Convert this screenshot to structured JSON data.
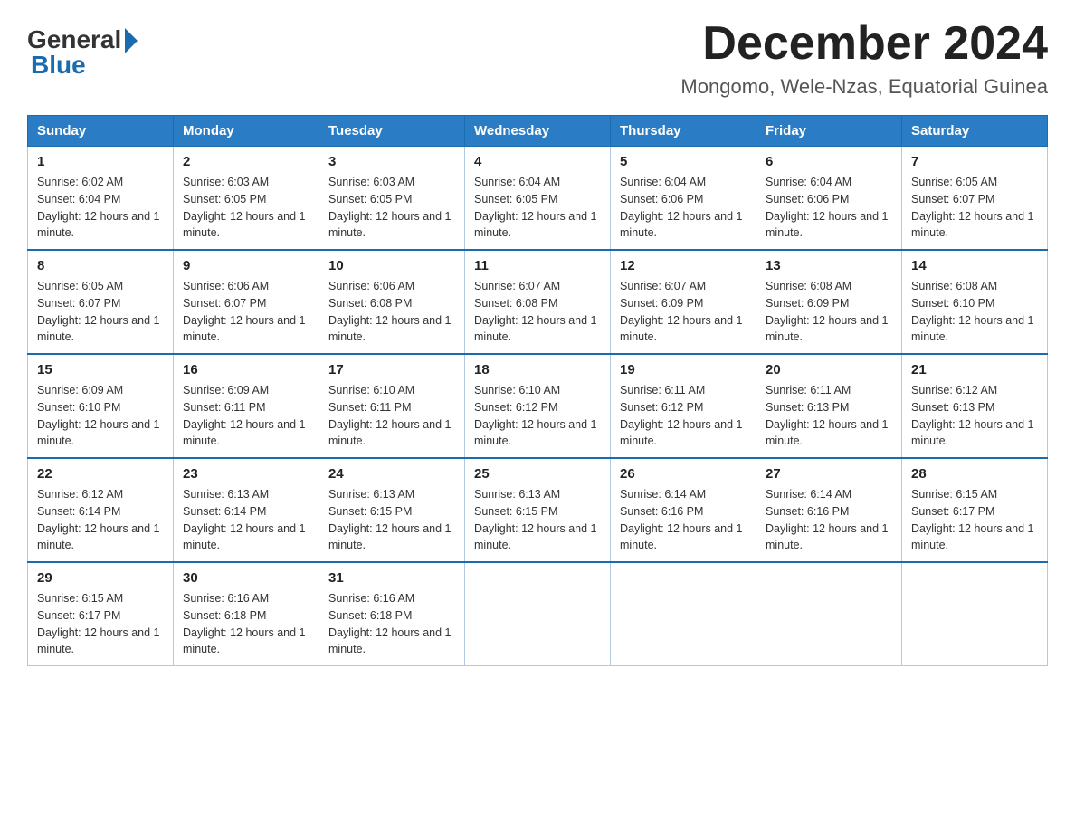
{
  "logo": {
    "general": "General",
    "blue": "Blue"
  },
  "title": "December 2024",
  "subtitle": "Mongomo, Wele-Nzas, Equatorial Guinea",
  "days_of_week": [
    "Sunday",
    "Monday",
    "Tuesday",
    "Wednesday",
    "Thursday",
    "Friday",
    "Saturday"
  ],
  "weeks": [
    [
      {
        "day": "1",
        "sunrise": "6:02 AM",
        "sunset": "6:04 PM",
        "daylight": "12 hours and 1 minute."
      },
      {
        "day": "2",
        "sunrise": "6:03 AM",
        "sunset": "6:05 PM",
        "daylight": "12 hours and 1 minute."
      },
      {
        "day": "3",
        "sunrise": "6:03 AM",
        "sunset": "6:05 PM",
        "daylight": "12 hours and 1 minute."
      },
      {
        "day": "4",
        "sunrise": "6:04 AM",
        "sunset": "6:05 PM",
        "daylight": "12 hours and 1 minute."
      },
      {
        "day": "5",
        "sunrise": "6:04 AM",
        "sunset": "6:06 PM",
        "daylight": "12 hours and 1 minute."
      },
      {
        "day": "6",
        "sunrise": "6:04 AM",
        "sunset": "6:06 PM",
        "daylight": "12 hours and 1 minute."
      },
      {
        "day": "7",
        "sunrise": "6:05 AM",
        "sunset": "6:07 PM",
        "daylight": "12 hours and 1 minute."
      }
    ],
    [
      {
        "day": "8",
        "sunrise": "6:05 AM",
        "sunset": "6:07 PM",
        "daylight": "12 hours and 1 minute."
      },
      {
        "day": "9",
        "sunrise": "6:06 AM",
        "sunset": "6:07 PM",
        "daylight": "12 hours and 1 minute."
      },
      {
        "day": "10",
        "sunrise": "6:06 AM",
        "sunset": "6:08 PM",
        "daylight": "12 hours and 1 minute."
      },
      {
        "day": "11",
        "sunrise": "6:07 AM",
        "sunset": "6:08 PM",
        "daylight": "12 hours and 1 minute."
      },
      {
        "day": "12",
        "sunrise": "6:07 AM",
        "sunset": "6:09 PM",
        "daylight": "12 hours and 1 minute."
      },
      {
        "day": "13",
        "sunrise": "6:08 AM",
        "sunset": "6:09 PM",
        "daylight": "12 hours and 1 minute."
      },
      {
        "day": "14",
        "sunrise": "6:08 AM",
        "sunset": "6:10 PM",
        "daylight": "12 hours and 1 minute."
      }
    ],
    [
      {
        "day": "15",
        "sunrise": "6:09 AM",
        "sunset": "6:10 PM",
        "daylight": "12 hours and 1 minute."
      },
      {
        "day": "16",
        "sunrise": "6:09 AM",
        "sunset": "6:11 PM",
        "daylight": "12 hours and 1 minute."
      },
      {
        "day": "17",
        "sunrise": "6:10 AM",
        "sunset": "6:11 PM",
        "daylight": "12 hours and 1 minute."
      },
      {
        "day": "18",
        "sunrise": "6:10 AM",
        "sunset": "6:12 PM",
        "daylight": "12 hours and 1 minute."
      },
      {
        "day": "19",
        "sunrise": "6:11 AM",
        "sunset": "6:12 PM",
        "daylight": "12 hours and 1 minute."
      },
      {
        "day": "20",
        "sunrise": "6:11 AM",
        "sunset": "6:13 PM",
        "daylight": "12 hours and 1 minute."
      },
      {
        "day": "21",
        "sunrise": "6:12 AM",
        "sunset": "6:13 PM",
        "daylight": "12 hours and 1 minute."
      }
    ],
    [
      {
        "day": "22",
        "sunrise": "6:12 AM",
        "sunset": "6:14 PM",
        "daylight": "12 hours and 1 minute."
      },
      {
        "day": "23",
        "sunrise": "6:13 AM",
        "sunset": "6:14 PM",
        "daylight": "12 hours and 1 minute."
      },
      {
        "day": "24",
        "sunrise": "6:13 AM",
        "sunset": "6:15 PM",
        "daylight": "12 hours and 1 minute."
      },
      {
        "day": "25",
        "sunrise": "6:13 AM",
        "sunset": "6:15 PM",
        "daylight": "12 hours and 1 minute."
      },
      {
        "day": "26",
        "sunrise": "6:14 AM",
        "sunset": "6:16 PM",
        "daylight": "12 hours and 1 minute."
      },
      {
        "day": "27",
        "sunrise": "6:14 AM",
        "sunset": "6:16 PM",
        "daylight": "12 hours and 1 minute."
      },
      {
        "day": "28",
        "sunrise": "6:15 AM",
        "sunset": "6:17 PM",
        "daylight": "12 hours and 1 minute."
      }
    ],
    [
      {
        "day": "29",
        "sunrise": "6:15 AM",
        "sunset": "6:17 PM",
        "daylight": "12 hours and 1 minute."
      },
      {
        "day": "30",
        "sunrise": "6:16 AM",
        "sunset": "6:18 PM",
        "daylight": "12 hours and 1 minute."
      },
      {
        "day": "31",
        "sunrise": "6:16 AM",
        "sunset": "6:18 PM",
        "daylight": "12 hours and 1 minute."
      },
      null,
      null,
      null,
      null
    ]
  ],
  "labels": {
    "sunrise": "Sunrise:",
    "sunset": "Sunset:",
    "daylight": "Daylight:"
  }
}
